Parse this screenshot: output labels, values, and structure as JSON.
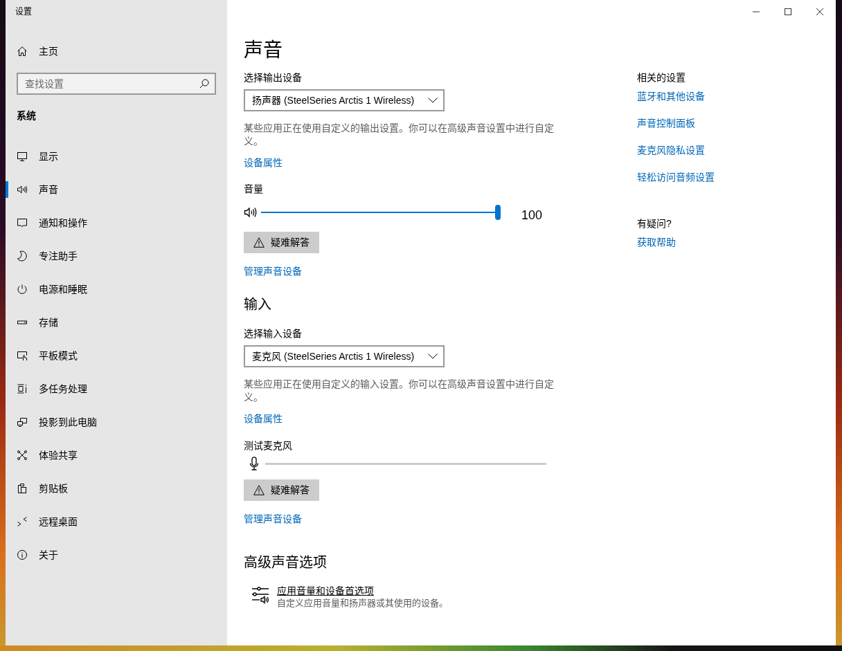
{
  "window": {
    "title": "设置"
  },
  "sidebar": {
    "home": "主页",
    "search": {
      "placeholder": "查找设置"
    },
    "section": "系统",
    "items": [
      {
        "label": "显示",
        "selected": false
      },
      {
        "label": "声音",
        "selected": true
      },
      {
        "label": "通知和操作",
        "selected": false
      },
      {
        "label": "专注助手",
        "selected": false
      },
      {
        "label": "电源和睡眠",
        "selected": false
      },
      {
        "label": "存储",
        "selected": false
      },
      {
        "label": "平板模式",
        "selected": false
      },
      {
        "label": "多任务处理",
        "selected": false
      },
      {
        "label": "投影到此电脑",
        "selected": false
      },
      {
        "label": "体验共享",
        "selected": false
      },
      {
        "label": "剪贴板",
        "selected": false
      },
      {
        "label": "远程桌面",
        "selected": false
      },
      {
        "label": "关于",
        "selected": false
      }
    ]
  },
  "page": {
    "title": "声音"
  },
  "output": {
    "label": "选择输出设备",
    "device": "扬声器 (SteelSeries Arctis 1 Wireless)",
    "note": "某些应用正在使用自定义的输出设置。你可以在高级声音设置中进行自定义。",
    "properties_link": "设备属性",
    "volume": {
      "label": "音量",
      "level": 1,
      "reading": "100"
    },
    "troubleshoot": "疑难解答",
    "manage_link": "管理声音设备"
  },
  "input": {
    "heading": "输入",
    "label": "选择输入设备",
    "device": "麦克风 (SteelSeries Arctis 1 Wireless)",
    "note": "某些应用正在使用自定义的输入设置。你可以在高级声音设置中进行自定义。",
    "properties_link": "设备属性",
    "test": {
      "label": "测试麦克风",
      "level": 0
    },
    "troubleshoot": "疑难解答",
    "manage_link": "管理声音设备"
  },
  "advanced": {
    "heading": "高级声音选项",
    "items": [
      {
        "title": "应用音量和设备首选项",
        "description": "自定义应用音量和扬声器或其使用的设备。"
      }
    ]
  },
  "related": {
    "heading": "相关的设置",
    "links": [
      "蓝牙和其他设备",
      "声音控制面板",
      "麦克风隐私设置",
      "轻松访问音频设置"
    ]
  },
  "help": {
    "heading": "有疑问?",
    "links": [
      "获取帮助"
    ]
  }
}
